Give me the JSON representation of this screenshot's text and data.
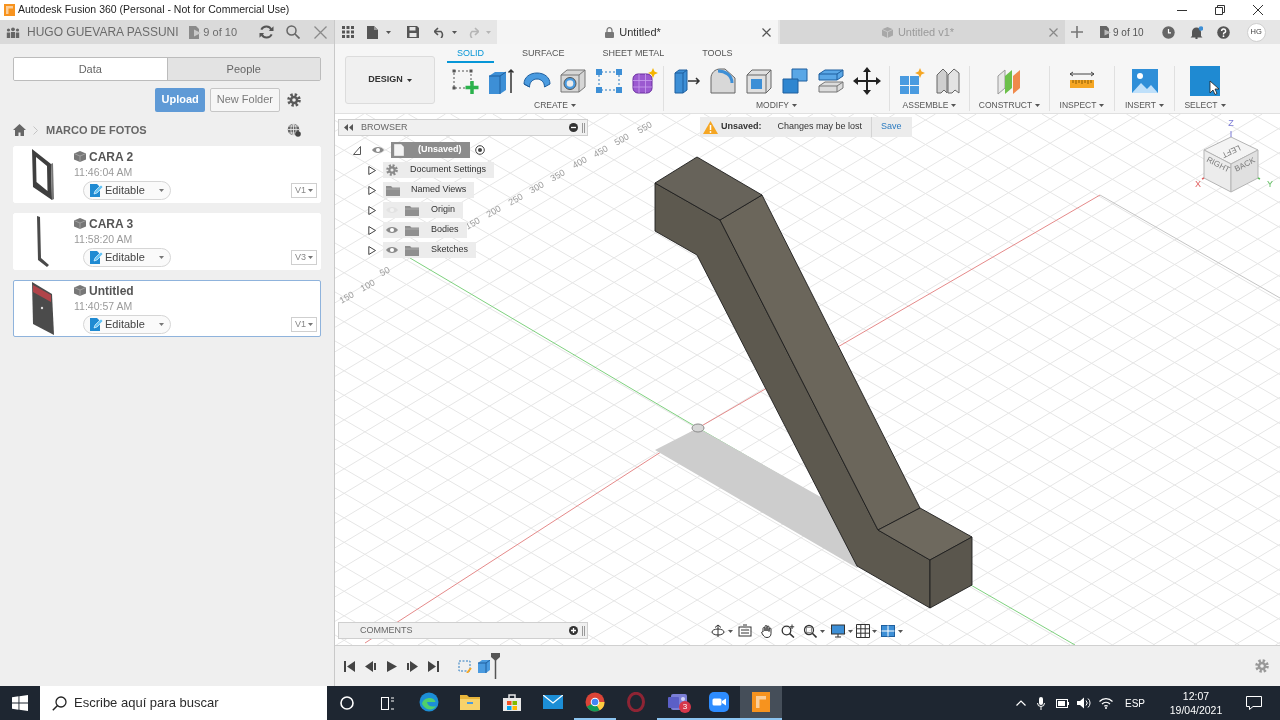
{
  "window": {
    "title": "Autodesk Fusion 360 (Personal - Not for Commercial Use)"
  },
  "data_panel": {
    "user": "HUGO GUEVARA PASSUNI",
    "doc_count": "9 of 10",
    "tabs": [
      {
        "label": "Data",
        "selected": true
      },
      {
        "label": "People",
        "selected": false
      }
    ],
    "buttons": [
      {
        "label": "Upload",
        "kind": "primary"
      },
      {
        "label": "New Folder",
        "kind": "secondary"
      }
    ],
    "breadcrumb": "MARCO DE FOTOS",
    "files": [
      {
        "name": "CARA 2",
        "time": "11:46:04 AM",
        "status": "Editable",
        "version": "V1",
        "kind": "frame",
        "selected": false
      },
      {
        "name": "CARA 3",
        "time": "11:58:20 AM",
        "status": "Editable",
        "version": "V3",
        "kind": "bar",
        "selected": false
      },
      {
        "name": "Untitled",
        "time": "11:40:57 AM",
        "status": "Editable",
        "version": "V1",
        "kind": "plate",
        "selected": true
      }
    ]
  },
  "document_tabs": [
    {
      "label": "Untitled*",
      "selected": true,
      "locked": true
    },
    {
      "label": "Untitled v1*",
      "selected": false,
      "locked": false
    }
  ],
  "header_right": {
    "doc_count": "9 of 10",
    "initials": "HG"
  },
  "toolbar": {
    "workspace": "DESIGN",
    "tabs": [
      {
        "label": "SOLID",
        "selected": true
      },
      {
        "label": "SURFACE",
        "selected": false
      },
      {
        "label": "SHEET METAL",
        "selected": false
      },
      {
        "label": "TOOLS",
        "selected": false
      }
    ],
    "groups": [
      "CREATE",
      "MODIFY",
      "ASSEMBLE",
      "CONSTRUCT",
      "INSPECT",
      "INSERT",
      "SELECT"
    ]
  },
  "browser": {
    "title": "BROWSER",
    "root": {
      "label": "(Unsaved)",
      "expanded": true,
      "selected": true,
      "children": [
        {
          "label": "Document Settings",
          "kind": "settings",
          "expanded": false,
          "selected": false
        },
        {
          "label": "Named Views",
          "kind": "views",
          "expanded": false,
          "selected": false
        },
        {
          "label": "Origin",
          "kind": "folder",
          "expanded": false,
          "selected": false,
          "visible": false
        },
        {
          "label": "Bodies",
          "kind": "folder",
          "expanded": false,
          "selected": false,
          "visible": true
        },
        {
          "label": "Sketches",
          "kind": "folder",
          "expanded": false,
          "selected": false,
          "visible": true
        }
      ]
    }
  },
  "unsaved_banner": {
    "label": "Unsaved:",
    "message": "Changes may be lost",
    "action": "Save"
  },
  "viewport": {
    "ruler_labels": [
      "550",
      "500",
      "450",
      "400",
      "350",
      "300",
      "250",
      "200",
      "150",
      "50",
      "100",
      "150"
    ],
    "view_cube": {
      "faces": [
        "LEFT",
        "RIGHT",
        "BACK"
      ],
      "axes": [
        "Z",
        "X",
        "Y"
      ]
    }
  },
  "comments": {
    "title": "COMMENTS"
  },
  "taskbar": {
    "search": {
      "placeholder": "Escribe aquí para buscar"
    },
    "apps": [
      {
        "running": false,
        "selected": false
      },
      {
        "running": false,
        "selected": false
      },
      {
        "running": false,
        "selected": false
      },
      {
        "running": false,
        "selected": false
      },
      {
        "running": true,
        "selected": false
      },
      {
        "running": false,
        "selected": false
      },
      {
        "running": true,
        "selected": false,
        "badge": "3"
      },
      {
        "running": true,
        "selected": false
      },
      {
        "running": true,
        "selected": true
      }
    ],
    "language": "ESP",
    "time": "12:07",
    "date": "19/04/2021"
  }
}
